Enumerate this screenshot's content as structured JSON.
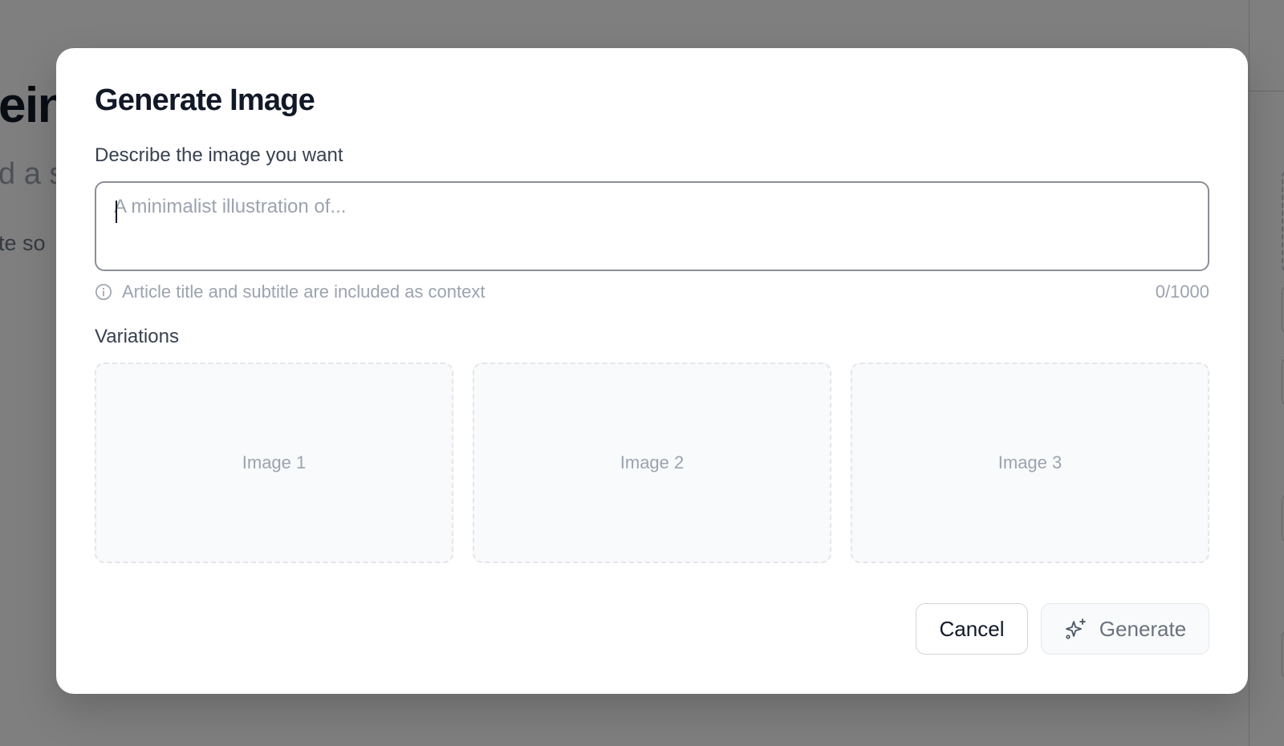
{
  "background": {
    "title_fragment": "ein",
    "subtitle_fragment": "d a s",
    "body_fragment": "te so"
  },
  "modal": {
    "title": "Generate Image",
    "prompt": {
      "label": "Describe the image you want",
      "placeholder": "A minimalist illustration of...",
      "value": ""
    },
    "hint": {
      "text": "Article title and subtitle are included as context",
      "icon": "info-icon"
    },
    "char_count": "0/1000",
    "variations": {
      "label": "Variations",
      "slots": [
        {
          "label": "Image 1"
        },
        {
          "label": "Image 2"
        },
        {
          "label": "Image 3"
        }
      ]
    },
    "buttons": {
      "cancel": "Cancel",
      "generate": "Generate",
      "generate_icon": "sparkle-icon"
    }
  },
  "colors": {
    "overlay": "#808080",
    "title_text": "#111827",
    "muted_text": "#9ca3af",
    "input_border": "#8b8f96",
    "slot_background": "#f9fafb"
  }
}
